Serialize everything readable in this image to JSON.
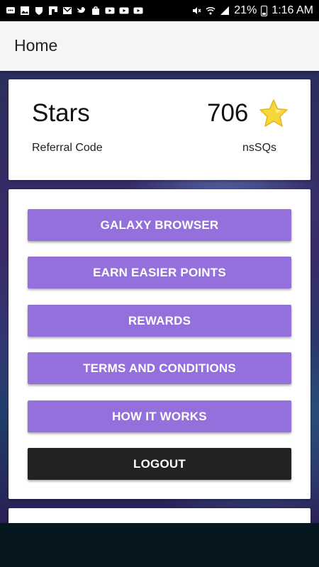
{
  "status_bar": {
    "battery_percent": "21%",
    "time": "1:16 AM",
    "left_icons": [
      "chat-icon",
      "image-icon",
      "shield-icon",
      "flipboard-icon",
      "gmail-icon",
      "twitter-icon",
      "bag-icon",
      "youtube-icon",
      "youtube-icon",
      "youtube-icon"
    ],
    "right_icons": [
      "mute-icon",
      "wifi-icon",
      "signal-icon",
      "battery-icon"
    ]
  },
  "app_bar": {
    "title": "Home"
  },
  "stars_card": {
    "label": "Stars",
    "value": "706",
    "referral_label": "Referral Code",
    "referral_code": "nsSQs"
  },
  "menu": {
    "buttons": [
      {
        "label": "GALAXY BROWSER"
      },
      {
        "label": "EARN EASIER POINTS"
      },
      {
        "label": "REWARDS"
      },
      {
        "label": "TERMS AND CONDITIONS"
      },
      {
        "label": "HOW IT WORKS"
      },
      {
        "label": "LOGOUT"
      }
    ]
  },
  "colors": {
    "button_purple": "#9370db",
    "button_dark": "#222222",
    "star": "#f5d63b"
  }
}
